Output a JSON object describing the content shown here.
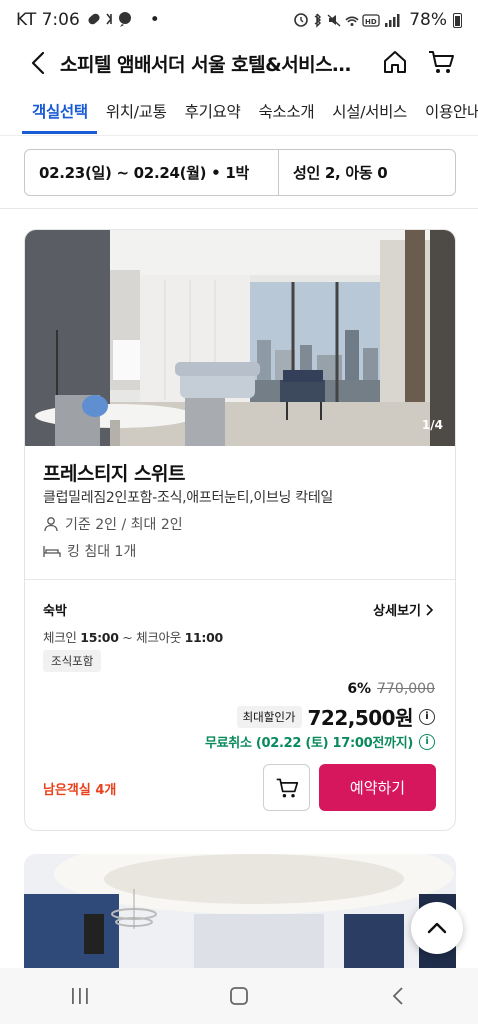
{
  "status_bar": {
    "time_label": "KT 7:06",
    "battery": "78%",
    "dot": "•"
  },
  "header": {
    "title": "소피텔 앰배서더 서울 호텔&서비스드 레지던스"
  },
  "tabs": [
    {
      "label": "객실선택",
      "active": true
    },
    {
      "label": "위치/교통"
    },
    {
      "label": "후기요약"
    },
    {
      "label": "숙소소개"
    },
    {
      "label": "시설/서비스"
    },
    {
      "label": "이용안내"
    }
  ],
  "filter": {
    "dates": "02.23(일) ~ 02.24(월) • 1박",
    "guests": "성인 2, 아동 0"
  },
  "room": {
    "image_counter": "1/4",
    "name": "프레스티지 스위트",
    "description": "클럽밀레짐2인포함-조식,애프터눈티,이브닝 칵테일",
    "capacity": "기준 2인 / 최대 2인",
    "bed": "킹 침대 1개",
    "stay_label": "숙박",
    "detail_link": "상세보기",
    "checkin_label": "체크인",
    "checkin_time": "15:00",
    "checkout_label": "~ 체크아웃",
    "checkout_time": "11:00",
    "breakfast_badge": "조식포함",
    "discount_pct": "6%",
    "original_price": "770,000",
    "max_discount_label": "최대할인가",
    "price": "722,500원",
    "free_cancel": "무료취소 (02.22 (토) 17:00전까지)",
    "rooms_left": "남은객실 4개",
    "reserve_label": "예약하기"
  },
  "colors": {
    "accent_blue": "#1a5bd6",
    "reserve_pink": "#d6175e",
    "cancel_green": "#0a8a5c",
    "rooms_left_orange": "#e8411c"
  }
}
